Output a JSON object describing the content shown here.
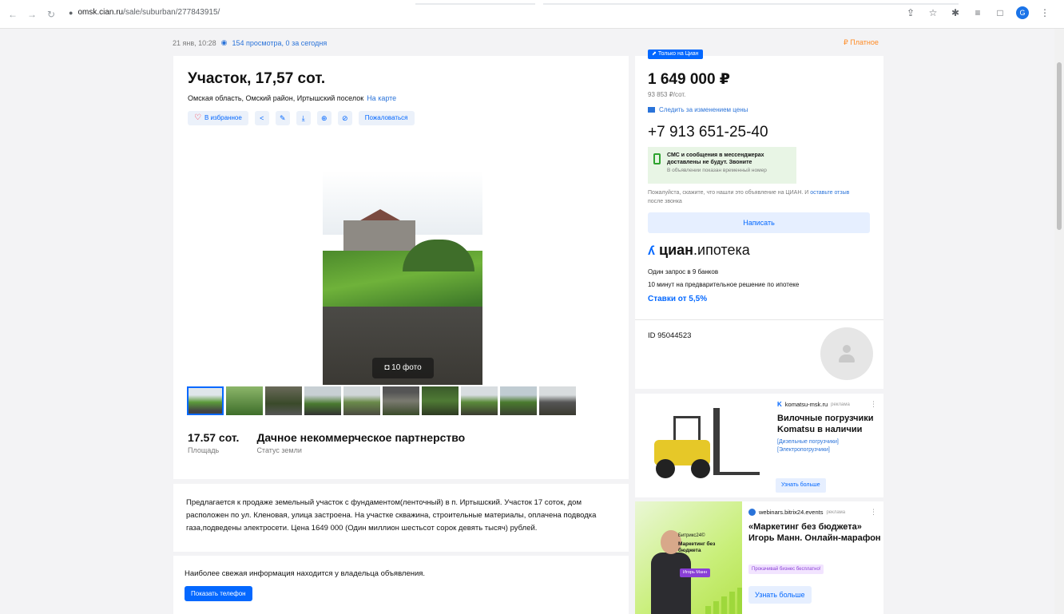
{
  "browser": {
    "url_host": "omsk.cian.ru",
    "url_path": "/sale/suburban/277843915/",
    "profile_initial": "G"
  },
  "meta": {
    "date": "21 янв, 10:28",
    "views": "154 просмотра, 0 за сегодня",
    "paid": "Платное"
  },
  "listing": {
    "title": "Участок, 17,57 сот.",
    "address": "Омская область, Омский район, Иртышский поселок",
    "map_link": "На карте",
    "favorite": "В избранное",
    "complain": "Пожаловаться",
    "photo_count": "10 фото",
    "area_value": "17.57 сот.",
    "area_label": "Площадь",
    "status_value": "Дачное некоммерческое партнерство",
    "status_label": "Статус земли",
    "description": "Предлагается к продаже земельный участок с фундаментом(ленточный) в п. Иртышский. Участок 17 соток, дом расположен по ул. Кленовая, улица застроена. На участке скважина, строительные материалы, оплачена подводка газа,подведены электросети. Цена 1649 000 (Один миллион шестьсот сорок девять тысяч) рублей.",
    "fresh_info": "Наиболее свежая информация находится у владельца объявления.",
    "show_phone": "Показать телефон"
  },
  "sidebar": {
    "only_cian": "Только на Циан",
    "price": "1 649 000 ₽",
    "price_per": "93 853 ₽/сот.",
    "follow_price": "Следить за изменением цены",
    "phone": "+7 913 651-25-40",
    "sms_title": "СМС и сообщения в мессенджерах доставлены не будут. Звоните",
    "sms_sub": "В объявлении показан временный номер",
    "review_text": "Пожалуйста, скажите, что нашли это объявление на ЦИАН. И",
    "review_link": "оставьте отзыв",
    "review_tail": "после звонка",
    "write": "Написать",
    "mortgage_brand": "циан",
    "mortgage_word": ".ипотека",
    "mortgage_line1": "Один запрос в 9 банков",
    "mortgage_line2": "10 минут на предварительное решение по ипотеке",
    "mortgage_rates": "Ставки от 5,5%",
    "id_text": "ID 95044523"
  },
  "ads": [
    {
      "source": "komatsu-msk.ru",
      "tag": "реклама",
      "title": "Вилочные погрузчики Komatsu в наличии",
      "link1": "[Дизельные погрузчики]",
      "link2": "[Электропогрузчики]",
      "button": "Узнать больше"
    },
    {
      "source": "webinars.bitrix24.events",
      "tag": "реклама",
      "title": "«Маркетинг без бюджета» Игорь Манн. Онлайн-марафон",
      "promo": "Прокачивай бизнес бесплатно!",
      "img_text1": "Битрикс24©",
      "img_text2": "Маркетинг без бюджета",
      "img_badge": "Игорь Манн",
      "button": "Узнать больше"
    }
  ],
  "colors": {
    "accent": "#0468ff",
    "link": "#2a73d9",
    "paid": "#ff8b25",
    "favorite": "#ff1f34"
  }
}
